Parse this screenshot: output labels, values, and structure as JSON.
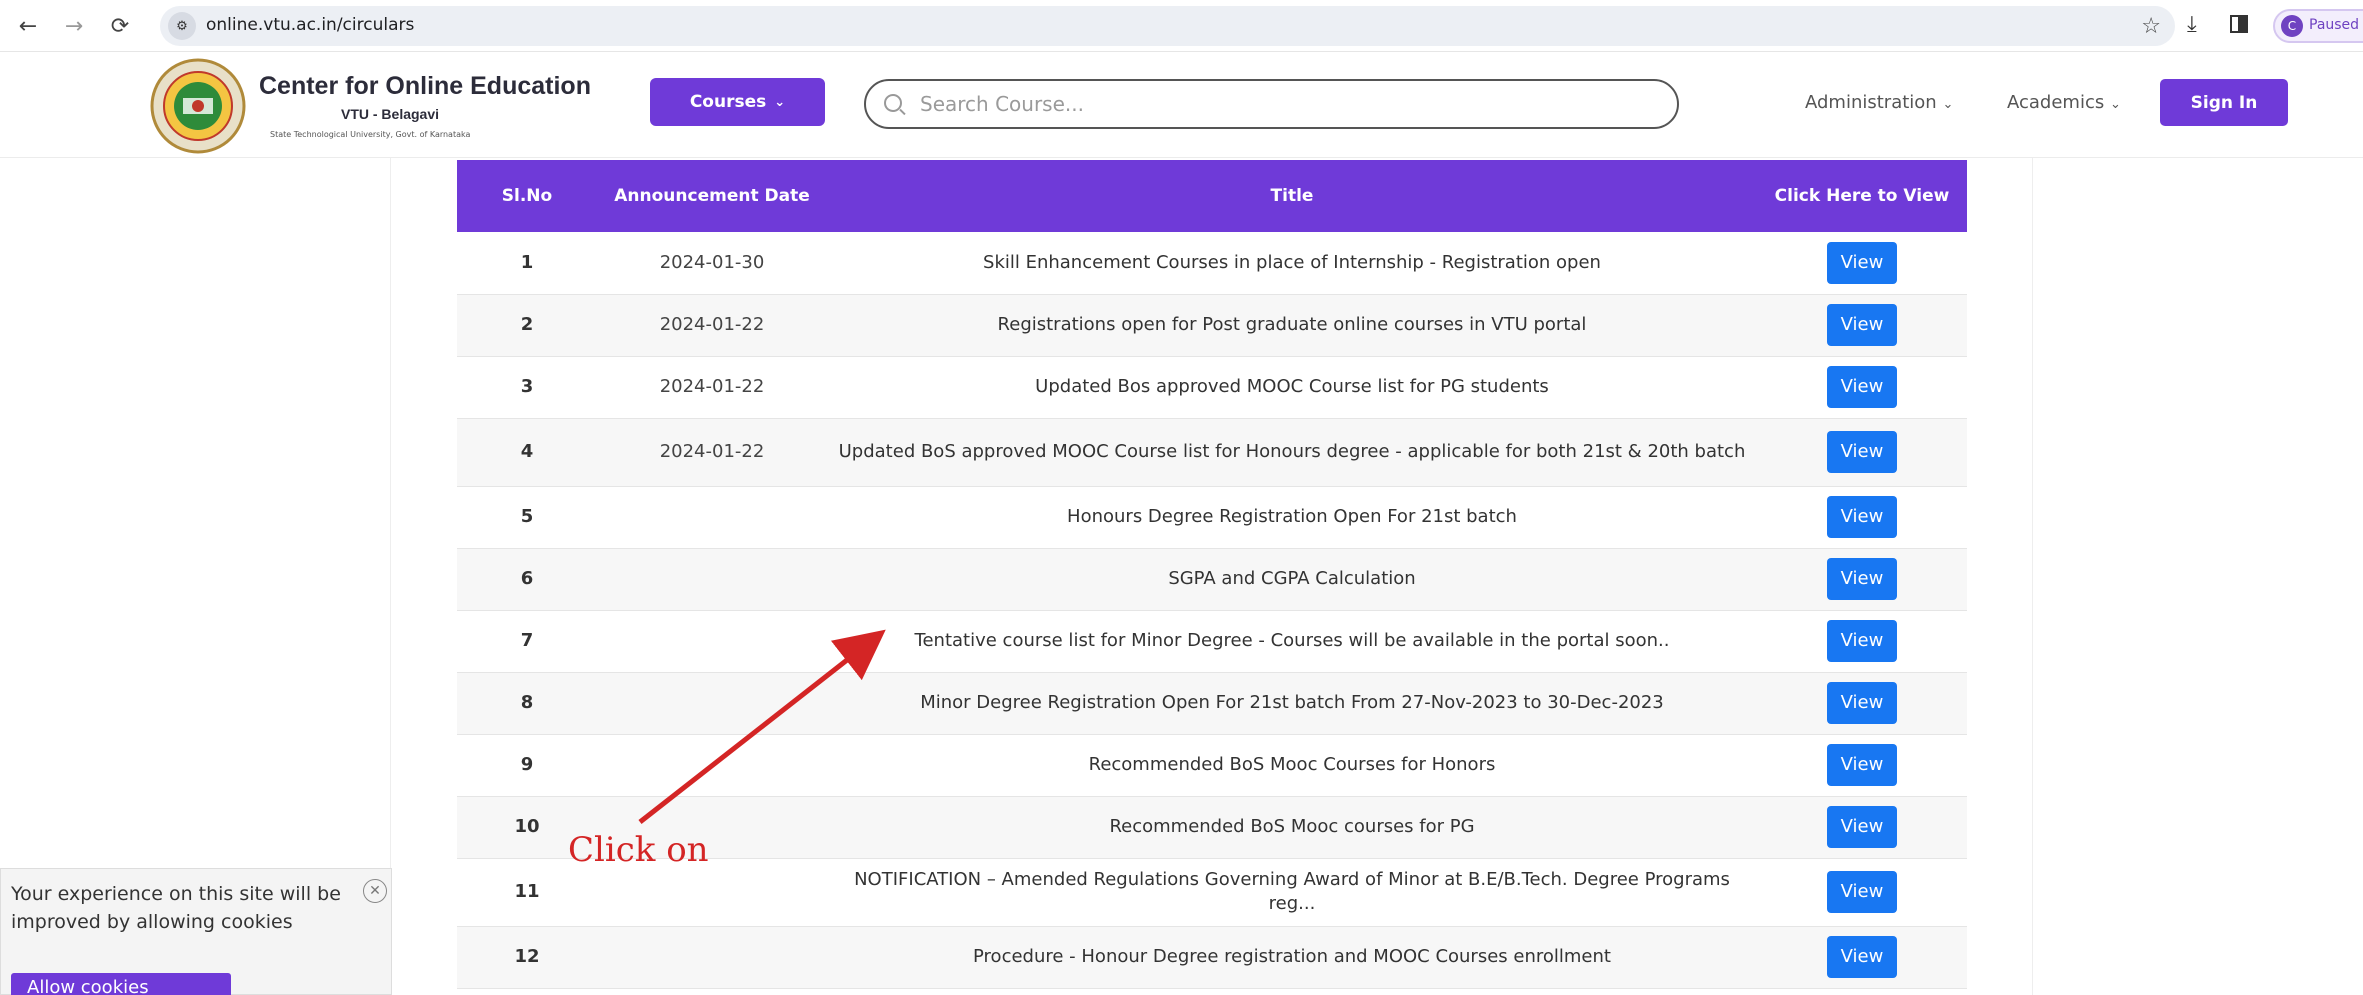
{
  "browser": {
    "url": "online.vtu.ac.in/circulars",
    "profile_initial": "C",
    "profile_status": "Paused"
  },
  "header": {
    "title": "Center for Online Education",
    "subtitle": "VTU - Belagavi",
    "tagline": "State Technological University, Govt. of Karnataka",
    "courses_label": "Courses",
    "search_placeholder": "Search Course...",
    "administration_label": "Administration",
    "academics_label": "Academics",
    "signin_label": "Sign In"
  },
  "table": {
    "headers": {
      "slno": "Sl.No",
      "date": "Announcement Date",
      "title": "Title",
      "action": "Click Here to View"
    },
    "view_label": "View",
    "rows": [
      {
        "sl": "1",
        "date": "2024-01-30",
        "title": "Skill Enhancement Courses in place of Internship - Registration open"
      },
      {
        "sl": "2",
        "date": "2024-01-22",
        "title": "Registrations open for Post graduate online courses in VTU portal"
      },
      {
        "sl": "3",
        "date": "2024-01-22",
        "title": "Updated Bos approved MOOC Course list for PG students"
      },
      {
        "sl": "4",
        "date": "2024-01-22",
        "title": "Updated BoS approved MOOC Course list for Honours degree - applicable for both 21st & 20th batch"
      },
      {
        "sl": "5",
        "date": "",
        "title": "Honours Degree Registration Open For 21st batch"
      },
      {
        "sl": "6",
        "date": "",
        "title": "SGPA and CGPA Calculation"
      },
      {
        "sl": "7",
        "date": "",
        "title": "Tentative course list for Minor Degree - Courses will be available in the portal soon.."
      },
      {
        "sl": "8",
        "date": "",
        "title": "Minor Degree Registration Open For 21st batch From 27-Nov-2023 to 30-Dec-2023"
      },
      {
        "sl": "9",
        "date": "",
        "title": "Recommended BoS Mooc Courses for Honors"
      },
      {
        "sl": "10",
        "date": "",
        "title": "Recommended BoS Mooc courses for PG"
      },
      {
        "sl": "11",
        "date": "",
        "title": "NOTIFICATION – Amended Regulations Governing Award of Minor at B.E/B.Tech. Degree Programs reg..."
      },
      {
        "sl": "12",
        "date": "",
        "title": "Procedure - Honour Degree registration and MOOC Courses enrollment"
      }
    ]
  },
  "annotation": {
    "text": "Click on",
    "color": "#d42525"
  },
  "cookie": {
    "message": "Your experience on this site will be improved by allowing cookies",
    "button_label": "Allow cookies"
  },
  "colors": {
    "brand": "#6f3ad8",
    "view_button": "#1877f2"
  }
}
